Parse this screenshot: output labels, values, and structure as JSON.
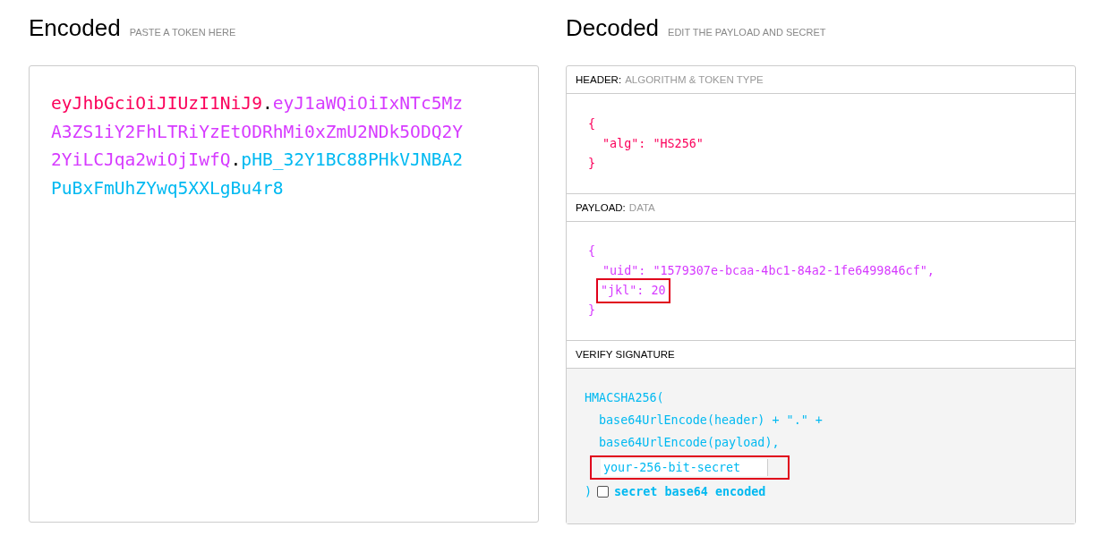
{
  "encoded": {
    "title": "Encoded",
    "subtitle": "PASTE A TOKEN HERE",
    "token": [
      {
        "kind": "header",
        "text": "eyJhbGciOiJIUzI1NiJ9"
      },
      {
        "kind": "dot",
        "text": "."
      },
      {
        "kind": "payload",
        "text": "eyJ1aWQiOiIxNTc5MzA3ZS1iY2FhLTRiYzEtODRhMi0xZmU2NDk5ODQ2Y2YiLCJqa2wiOjIwfQ"
      },
      {
        "kind": "dot",
        "text": "."
      },
      {
        "kind": "signature",
        "text": "pHB_32Y1BC88PHkVJNBA2PuBxFmUhZYwq5XXLgBu4r8"
      }
    ]
  },
  "decoded": {
    "title": "Decoded",
    "subtitle": "EDIT THE PAYLOAD AND SECRET",
    "header": {
      "label": "HEADER:",
      "sublabel": "ALGORITHM & TOKEN TYPE",
      "lines": [
        {
          "kind": "brace",
          "text": "{",
          "highlighted": false
        },
        {
          "kind": "entry",
          "text": "\"alg\": \"HS256\"",
          "highlighted": false
        },
        {
          "kind": "brace",
          "text": "}",
          "highlighted": false
        }
      ]
    },
    "payload": {
      "label": "PAYLOAD:",
      "sublabel": "DATA",
      "lines": [
        {
          "kind": "brace",
          "text": "{",
          "highlighted": false
        },
        {
          "kind": "entry",
          "text": "\"uid\": \"1579307e-bcaa-4bc1-84a2-1fe6499846cf\",",
          "highlighted": false
        },
        {
          "kind": "entry",
          "text": "\"jkl\": 20",
          "highlighted": true
        },
        {
          "kind": "brace",
          "text": "}",
          "highlighted": false
        }
      ]
    },
    "signature": {
      "label": "VERIFY SIGNATURE",
      "lines": [
        "HMACSHA256(",
        "base64UrlEncode(header) + \".\" +",
        "base64UrlEncode(payload),"
      ],
      "secret": {
        "value": "your-256-bit-secret",
        "highlighted": true
      },
      "close": ")",
      "checkbox": {
        "label": "secret base64 encoded",
        "checked": false
      }
    }
  }
}
